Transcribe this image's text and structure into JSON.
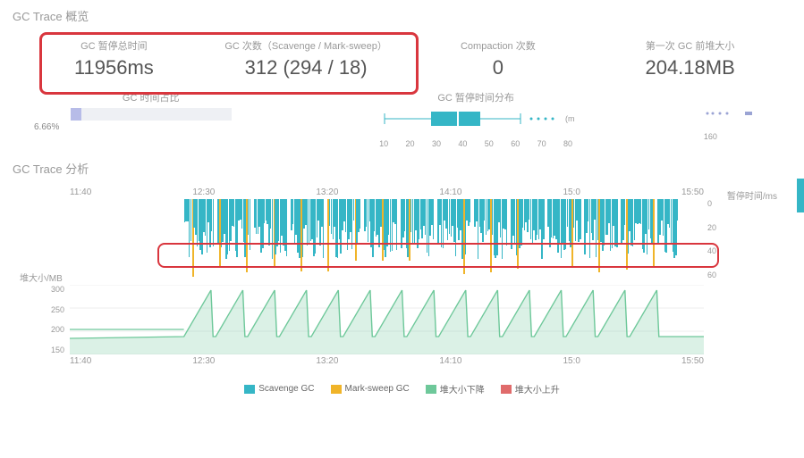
{
  "overview_title": "GC Trace 概览",
  "analysis_title": "GC Trace 分析",
  "stats": {
    "pause_total": {
      "label": "GC 暂停总时间",
      "value": "11956ms"
    },
    "count": {
      "label": "GC 次数（Scavenge / Mark-sweep）",
      "value": "312 (294 / 18)"
    },
    "compaction": {
      "label": "Compaction 次数",
      "value": "0"
    },
    "first_heap": {
      "label": "第一次 GC 前堆大小",
      "value": "204.18MB"
    }
  },
  "gc_time_ratio": {
    "label": "GC 时间占比",
    "pct": 6.66,
    "text": "6.66%"
  },
  "pause_dist": {
    "label": "GC 暂停时间分布",
    "unit": "(ms)",
    "ticks": [
      "10",
      "20",
      "30",
      "40",
      "50",
      "60",
      "70",
      "80"
    ]
  },
  "scatter_tick": "160",
  "timeline": [
    "11:40",
    "12:30",
    "13:20",
    "14:10",
    "15:0",
    "15:50"
  ],
  "gc_y": [
    "0",
    "20",
    "40",
    "60"
  ],
  "heap_y": [
    "300",
    "250",
    "200",
    "150"
  ],
  "heap_xlabel": "堆大小/MB",
  "pause_xlabel": "暂停时间/ms",
  "legend": {
    "scavenge": "Scavenge GC",
    "marksweep": "Mark-sweep GC",
    "heap_down": "堆大小下降",
    "heap_up": "堆大小上升"
  },
  "chart_data": {
    "type": "mixed",
    "boxplot": {
      "min": 10,
      "q1": 30,
      "median": 40,
      "q3": 50,
      "max": 70,
      "outliers": [
        75,
        78,
        80
      ],
      "unit": "ms"
    },
    "gc_events": {
      "type": "bar",
      "x_range": [
        "11:40",
        "15:50"
      ],
      "y_range_ms": [
        0,
        70
      ],
      "series": [
        {
          "name": "Scavenge GC",
          "color": "#35b6c6",
          "count": 294,
          "typical_pause_ms": 35
        },
        {
          "name": "Mark-sweep GC",
          "color": "#f0b429",
          "count": 18,
          "typical_pause_ms": 55
        }
      ],
      "ylabel": "暂停时间/ms"
    },
    "heap_size": {
      "type": "area",
      "x_range": [
        "11:40",
        "15:50"
      ],
      "y_range_mb": [
        150,
        300
      ],
      "pattern": "sawtooth oscillation between ~180MB and ~290MB, ~15 cycles",
      "ylabel": "堆大小/MB",
      "color": "#6ec89a"
    }
  }
}
